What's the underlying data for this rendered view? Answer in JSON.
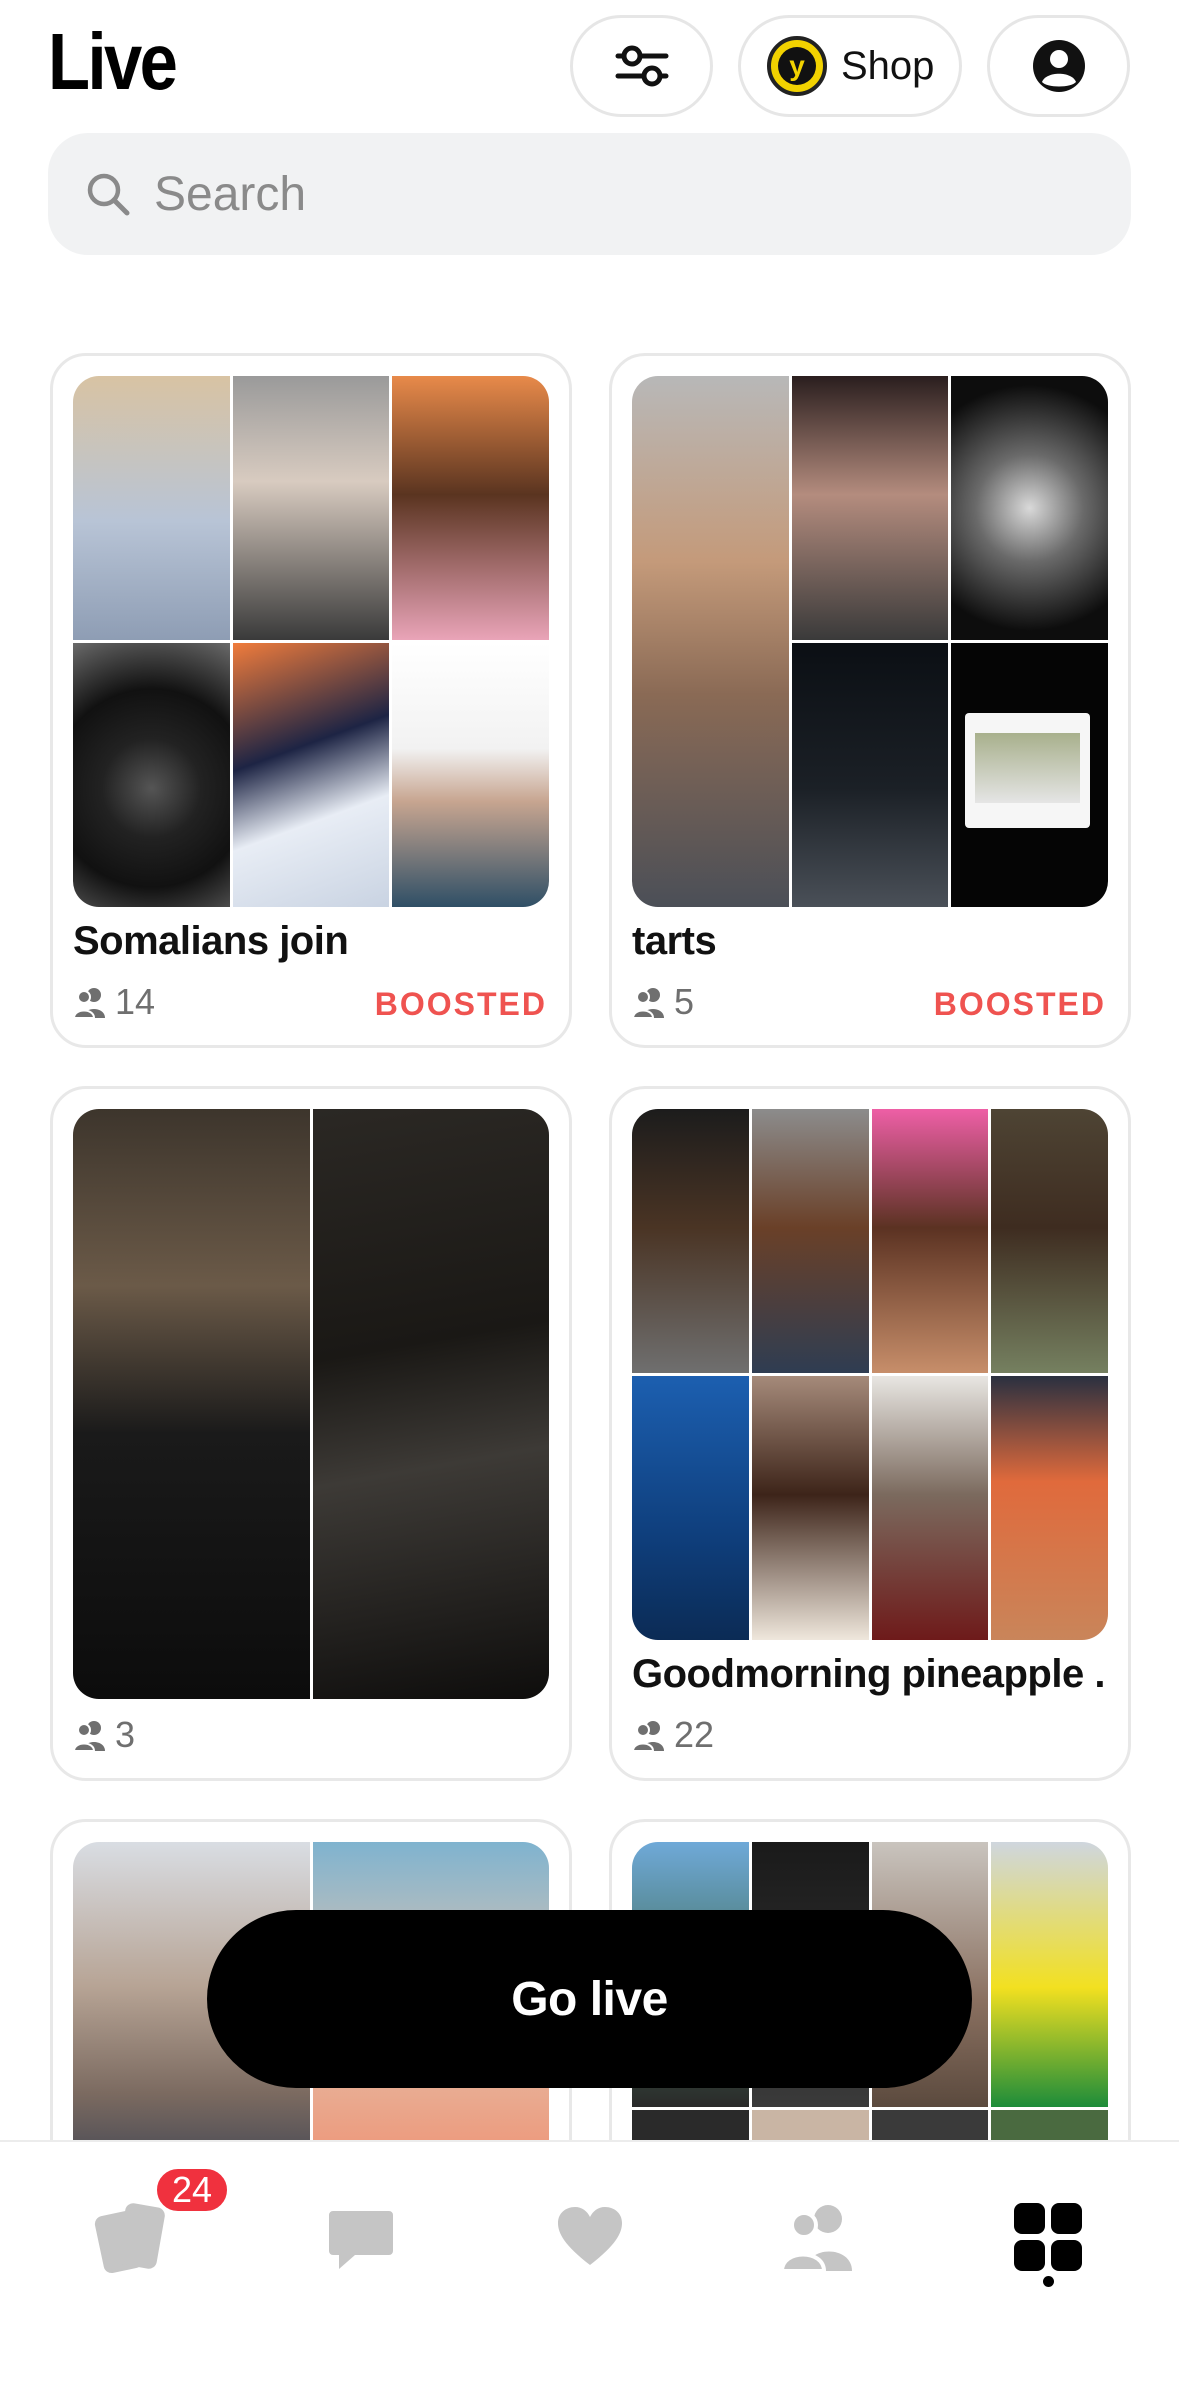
{
  "header": {
    "title": "Live",
    "shop_label": "Shop",
    "coin_glyph": "y"
  },
  "search": {
    "placeholder": "Search"
  },
  "cards": [
    {
      "title": "Somalians join",
      "viewers": "14",
      "tag": "BOOSTED"
    },
    {
      "title": "tarts",
      "viewers": "5",
      "tag": "BOOSTED"
    },
    {
      "title": "",
      "viewers": "3",
      "tag": ""
    },
    {
      "title": "Goodmorning pineapple .",
      "viewers": "22",
      "tag": ""
    }
  ],
  "go_live_label": "Go live",
  "nav": {
    "badge_count": "24",
    "items": [
      "cards-icon",
      "chat-icon",
      "heart-icon",
      "people-icon",
      "grid-icon"
    ],
    "active": "grid-icon"
  },
  "colors": {
    "boost": "#ef5350",
    "badge": "#f0313e",
    "coin": "#f2d200",
    "search_bg": "#f1f2f3"
  }
}
